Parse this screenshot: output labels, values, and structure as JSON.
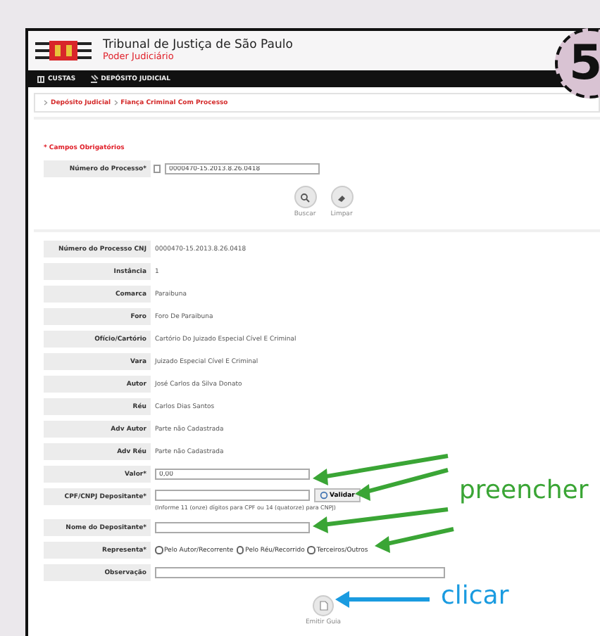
{
  "step_badge": "5",
  "header": {
    "title": "Tribunal de Justiça de São Paulo",
    "subtitle": "Poder Judiciário"
  },
  "nav": [
    {
      "label": "CUSTAS",
      "kind": "building"
    },
    {
      "label": "DEPÓSITO JUDICIAL",
      "kind": "gavel"
    }
  ],
  "breadcrumb": [
    "Depósito Judicial",
    "Fiança Criminal Com Processo"
  ],
  "required_note": "* Campos Obrigatórios",
  "search": {
    "label": "Número do Processo*",
    "value": "0000470-15.2013.8.26.0418",
    "buttons": [
      {
        "label": "Buscar",
        "kind": "search"
      },
      {
        "label": "Limpar",
        "kind": "clear"
      }
    ]
  },
  "details": [
    {
      "label": "Número do Processo CNJ",
      "value": "0000470-15.2013.8.26.0418"
    },
    {
      "label": "Instância",
      "value": "1"
    },
    {
      "label": "Comarca",
      "value": "Paraibuna"
    },
    {
      "label": "Foro",
      "value": "Foro De Paraibuna"
    },
    {
      "label": "Ofício/Cartório",
      "value": "Cartório Do Juizado Especial Cível E Criminal"
    },
    {
      "label": "Vara",
      "value": "Juizado Especial Cível E Criminal"
    },
    {
      "label": "Autor",
      "value": "José Carlos da Silva Donato"
    },
    {
      "label": "Réu",
      "value": "Carlos Dias Santos"
    },
    {
      "label": "Adv Autor",
      "value": "Parte não Cadastrada"
    },
    {
      "label": "Adv Réu",
      "value": "Parte não Cadastrada"
    }
  ],
  "form": [
    {
      "kind": "text",
      "label": "Valor*",
      "value": "0,00"
    },
    {
      "kind": "validate",
      "label": "CPF/CNPJ Depositante*",
      "button": "Validar",
      "hint": "(Informe 11 (onze) dígitos para CPF ou 14 (quatorze) para CNPJ)"
    },
    {
      "kind": "text",
      "label": "Nome do Depositante*"
    },
    {
      "kind": "radio",
      "label": "Representa*",
      "options": [
        {
          "label": "Pelo Autor/Recorrente",
          "selected": false
        },
        {
          "label": "Pelo Réu/Recorrido",
          "selected": false
        },
        {
          "label": "Terceiros/Outros",
          "selected": false
        }
      ]
    },
    {
      "kind": "wide",
      "label": "Observação"
    }
  ],
  "submit": {
    "label": "Emitir Guia"
  },
  "annotations": [
    {
      "kind": "fill",
      "text": "preencher"
    },
    {
      "kind": "click",
      "text": "clicar"
    }
  ]
}
